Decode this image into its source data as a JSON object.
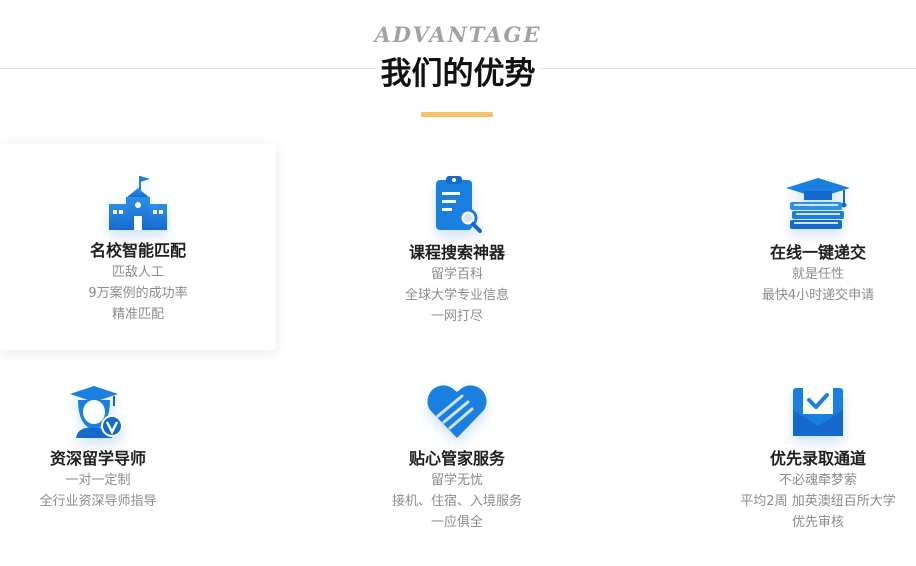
{
  "header": {
    "eyebrow": "ADVANTAGE",
    "title": "我们的优势"
  },
  "colors": {
    "accent_bar": "#f5c16b",
    "icon_blue": "#1a80e0",
    "icon_blue_dark": "#0f63c2"
  },
  "cards": [
    {
      "title": "名校智能匹配",
      "icon": "school-building-icon",
      "lines": [
        "匹敌人工",
        "9万案例的成功率",
        "精准匹配"
      ]
    },
    {
      "title": "课程搜索神器",
      "icon": "clipboard-search-icon",
      "lines": [
        "留学百科",
        "全球大学专业信息",
        "一网打尽"
      ]
    },
    {
      "title": "在线一键递交",
      "icon": "graduation-books-icon",
      "lines": [
        "就是任性",
        "最快4小时递交申请"
      ]
    },
    {
      "title": "资深留学导师",
      "icon": "mentor-avatar-icon",
      "lines": [
        "一对一定制",
        "全行业资深导师指导"
      ]
    },
    {
      "title": "贴心管家服务",
      "icon": "heart-hands-icon",
      "lines": [
        "留学无忧",
        "接机、住宿、入境服务",
        "一应俱全"
      ]
    },
    {
      "title": "优先录取通道",
      "icon": "mail-check-icon",
      "lines": [
        "不必魂牵梦萦",
        "平均2周 加英澳纽百所大学",
        "优先审核"
      ]
    }
  ]
}
